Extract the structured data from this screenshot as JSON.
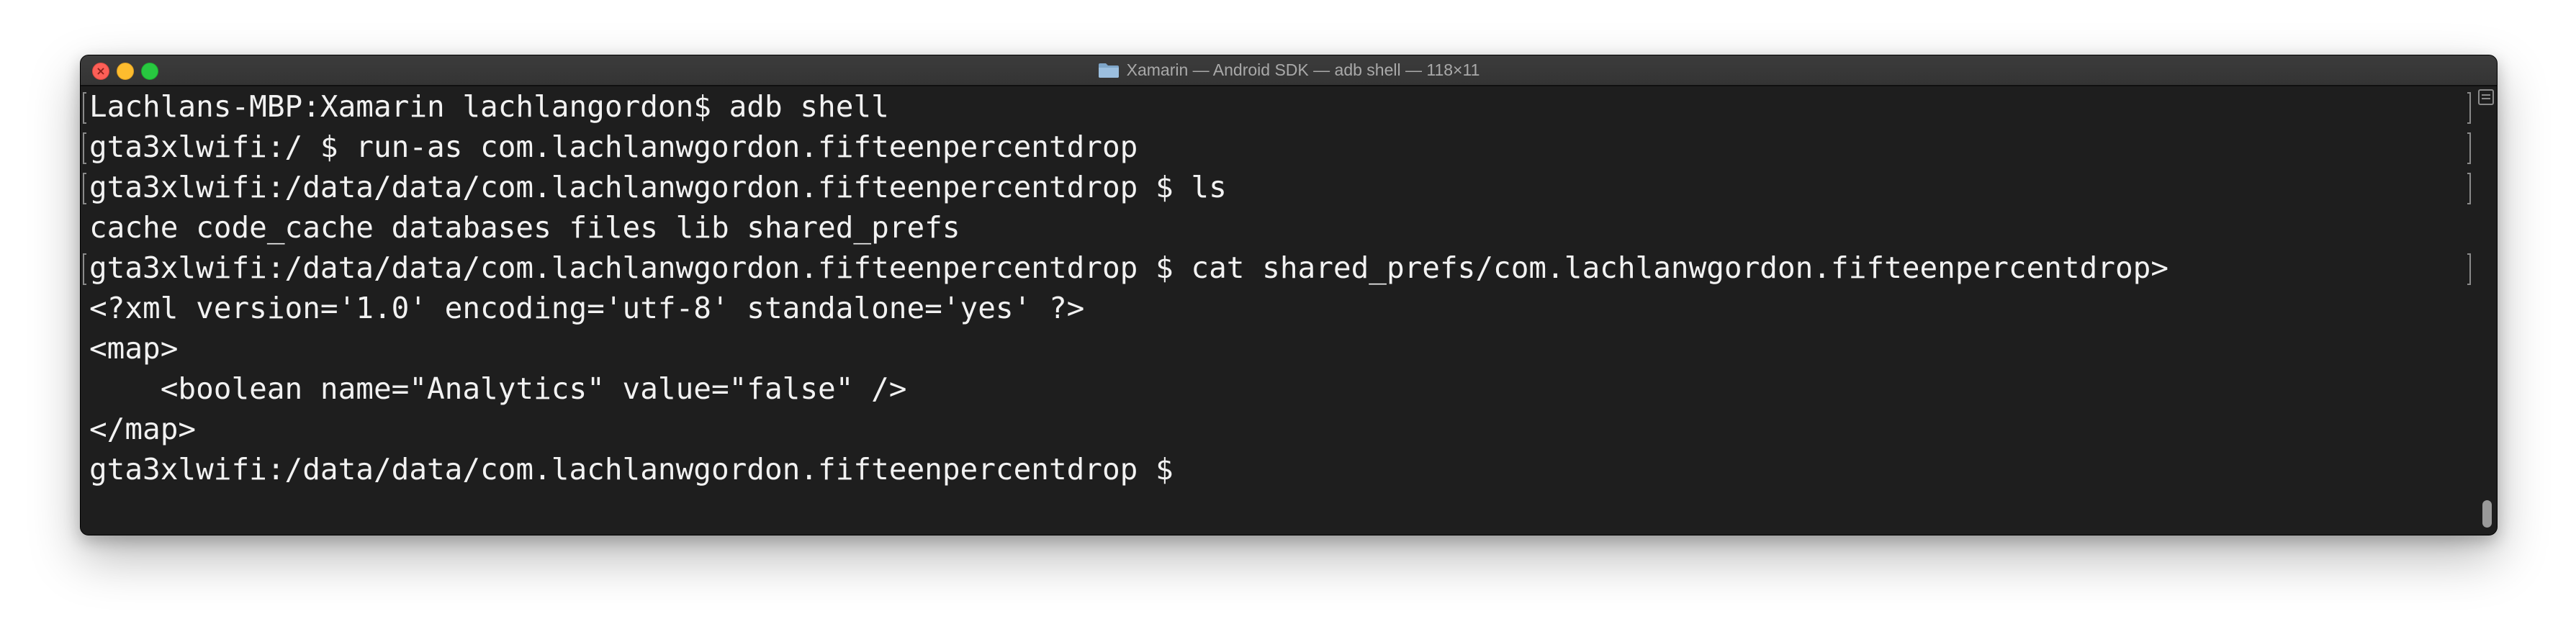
{
  "window": {
    "title": "Xamarin — Android SDK — adb shell — 118×11",
    "folder_icon": "folder-icon"
  },
  "terminal": {
    "lines": [
      "Lachlans-MBP:Xamarin lachlangordon$ adb shell",
      "gta3xlwifi:/ $ run-as com.lachlanwgordon.fifteenpercentdrop",
      "gta3xlwifi:/data/data/com.lachlanwgordon.fifteenpercentdrop $ ls",
      "cache code_cache databases files lib shared_prefs",
      "gta3xlwifi:/data/data/com.lachlanwgordon.fifteenpercentdrop $ cat shared_prefs/com.lachlanwgordon.fifteenpercentdrop>",
      "<?xml version='1.0' encoding='utf-8' standalone='yes' ?>",
      "<map>",
      "    <boolean name=\"Analytics\" value=\"false\" />",
      "</map>",
      "gta3xlwifi:/data/data/com.lachlanwgordon.fifteenpercentdrop $"
    ]
  },
  "colors": {
    "terminal_background": "#1e1e1e",
    "terminal_text": "#f2f2f2",
    "close_button": "#fd5f57",
    "minimize_button": "#fdbc2e",
    "zoom_button": "#28c840"
  }
}
